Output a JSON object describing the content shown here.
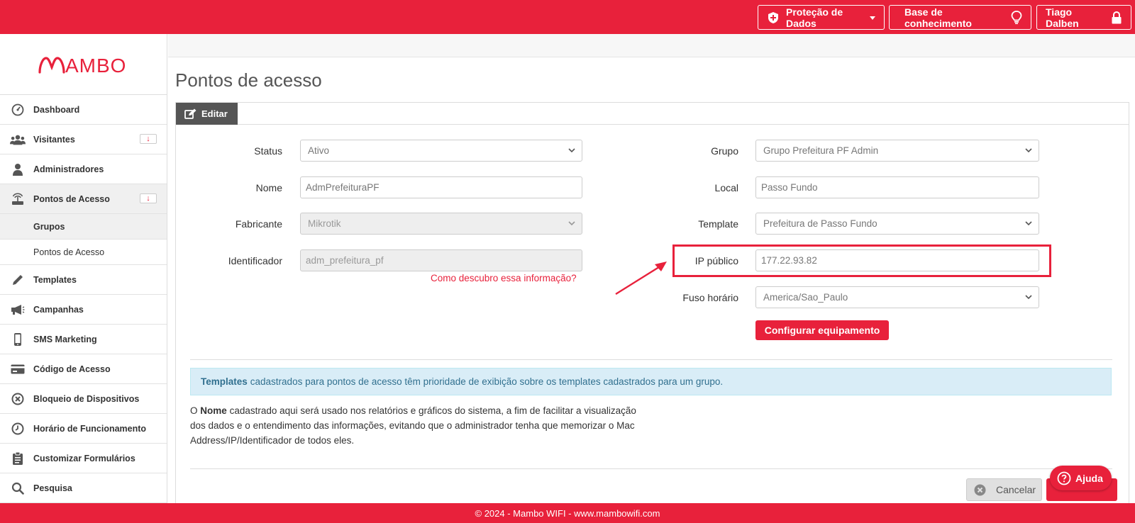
{
  "topbar": {
    "data_protection_label": "Proteção de Dados",
    "knowledge_base_label": "Base de conhecimento",
    "user_name": "Tiago Dalben"
  },
  "brand": {
    "logo_text": "MAMBO",
    "accent_color": "#e8213b"
  },
  "sidebar": {
    "items": [
      {
        "label": "Dashboard",
        "icon": "dashboard-icon"
      },
      {
        "label": "Visitantes",
        "icon": "users-icon",
        "badge": "↓"
      },
      {
        "label": "Administradores",
        "icon": "user-icon"
      },
      {
        "label": "Pontos de Acesso",
        "icon": "access-point-icon",
        "badge": "↓"
      },
      {
        "label": "Grupos"
      },
      {
        "label": "Pontos de Acesso"
      },
      {
        "label": "Templates",
        "icon": "pencil-icon"
      },
      {
        "label": "Campanhas",
        "icon": "megaphone-icon"
      },
      {
        "label": "SMS Marketing",
        "icon": "phone-icon"
      },
      {
        "label": "Código de Acesso",
        "icon": "card-icon"
      },
      {
        "label": "Bloqueio de Dispositivos",
        "icon": "block-icon"
      },
      {
        "label": "Horário de Funcionamento",
        "icon": "clock-icon"
      },
      {
        "label": "Customizar Formulários",
        "icon": "clipboard-icon"
      },
      {
        "label": "Pesquisa",
        "icon": "search-icon"
      }
    ]
  },
  "page": {
    "title": "Pontos de acesso",
    "tab_label": "Editar"
  },
  "form": {
    "status_label": "Status",
    "status_value": "Ativo",
    "nome_label": "Nome",
    "nome_value": "AdmPrefeituraPF",
    "fabricante_label": "Fabricante",
    "fabricante_value": "Mikrotik",
    "identificador_label": "Identificador",
    "identificador_value": "adm_prefeitura_pf",
    "identificador_help_link": "Como descubro essa informação?",
    "grupo_label": "Grupo",
    "grupo_value": "Grupo Prefeitura PF Admin",
    "local_label": "Local",
    "local_value": "Passo Fundo",
    "template_label": "Template",
    "template_value": "Prefeitura de Passo Fundo",
    "ip_label": "IP público",
    "ip_value": "177.22.93.82",
    "fuso_label": "Fuso horário",
    "fuso_value": "America/Sao_Paulo",
    "configure_button": "Configurar equipamento"
  },
  "info": {
    "templates_bold": "Templates",
    "templates_text": "cadastrados para pontos de acesso têm prioridade de exibição sobre os templates cadastrados para um grupo.",
    "nome_prefix": "O",
    "nome_bold": "Nome",
    "nome_text": "cadastrado aqui será usado nos relatórios e gráficos do sistema, a fim de facilitar a visualização dos dados e o entendimento das informações, evitando que o administrador tenha que memorizar o Mac Address/IP/Identificador de todos eles."
  },
  "actions": {
    "cancel_label": "Cancelar",
    "help_label": "Ajuda"
  },
  "footer": {
    "text": "© 2024 - Mambo WIFI - www.mambowifi.com"
  }
}
